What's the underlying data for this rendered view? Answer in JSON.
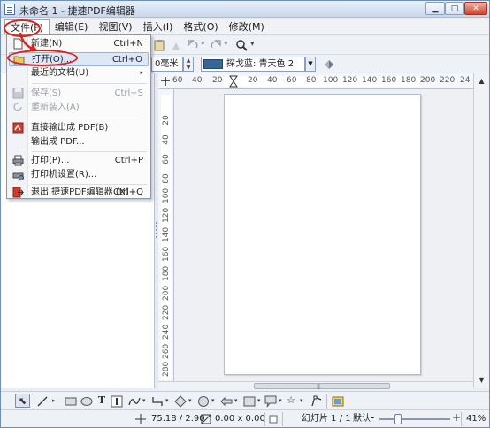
{
  "window": {
    "title": "未命名 1 - 捷速PDF编辑器"
  },
  "window_controls": {
    "minimize": "▁",
    "maximize": "□",
    "close": "✕"
  },
  "menubar": [
    {
      "label": "文件(F)",
      "active": true
    },
    {
      "label": "编辑(E)"
    },
    {
      "label": "视图(V)"
    },
    {
      "label": "插入(I)"
    },
    {
      "label": "格式(O)"
    },
    {
      "label": "修改(M)"
    }
  ],
  "toolbar2": {
    "size_field": "0毫米",
    "color_name": "探戈蓝: 青天色 2"
  },
  "file_menu": [
    {
      "label": "新建(N)",
      "shortcut": "Ctrl+N",
      "icon": "new-document-icon"
    },
    {
      "label": "打开(O)...",
      "shortcut": "Ctrl+O",
      "icon": "open-folder-icon",
      "highlighted": true
    },
    {
      "label": "最近的文档(U)",
      "submenu": "▸"
    },
    {
      "label": "保存(S)",
      "shortcut": "Ctrl+S",
      "icon": "save-icon",
      "disabled": true
    },
    {
      "label": "重新装入(A)",
      "icon": "reload-icon",
      "disabled": true
    },
    {
      "label": "直接输出成 PDF(B)",
      "icon": "pdf-icon"
    },
    {
      "label": "输出成 PDF..."
    },
    {
      "label": "打印(P)...",
      "shortcut": "Ctrl+P",
      "icon": "printer-icon"
    },
    {
      "label": "打印机设置(R)...",
      "icon": "printer-settings-icon"
    },
    {
      "label": "退出 捷速PDF编辑器 (X)",
      "shortcut": "Ctrl+Q",
      "icon": "exit-icon"
    }
  ],
  "hruler": [
    "60",
    "40",
    "20",
    "20",
    "40",
    "60",
    "80",
    "100",
    "120",
    "140",
    "160",
    "180",
    "200",
    "220",
    "24"
  ],
  "vruler": [
    "20",
    "40",
    "60",
    "80",
    "100",
    "120",
    "140",
    "160",
    "180",
    "200",
    "220",
    "240",
    "260",
    "280"
  ],
  "statusbar": {
    "position": "75.18 / 2.90",
    "size": "0.00 x 0.00",
    "slide": "幻灯片 1 / 1",
    "layout": "默认",
    "minus": "-",
    "plus": "+",
    "zoom": "41%",
    "zoom_level": 0.41
  },
  "colors": {
    "accent_red": "#e0201a",
    "swatch": "#36679b"
  }
}
